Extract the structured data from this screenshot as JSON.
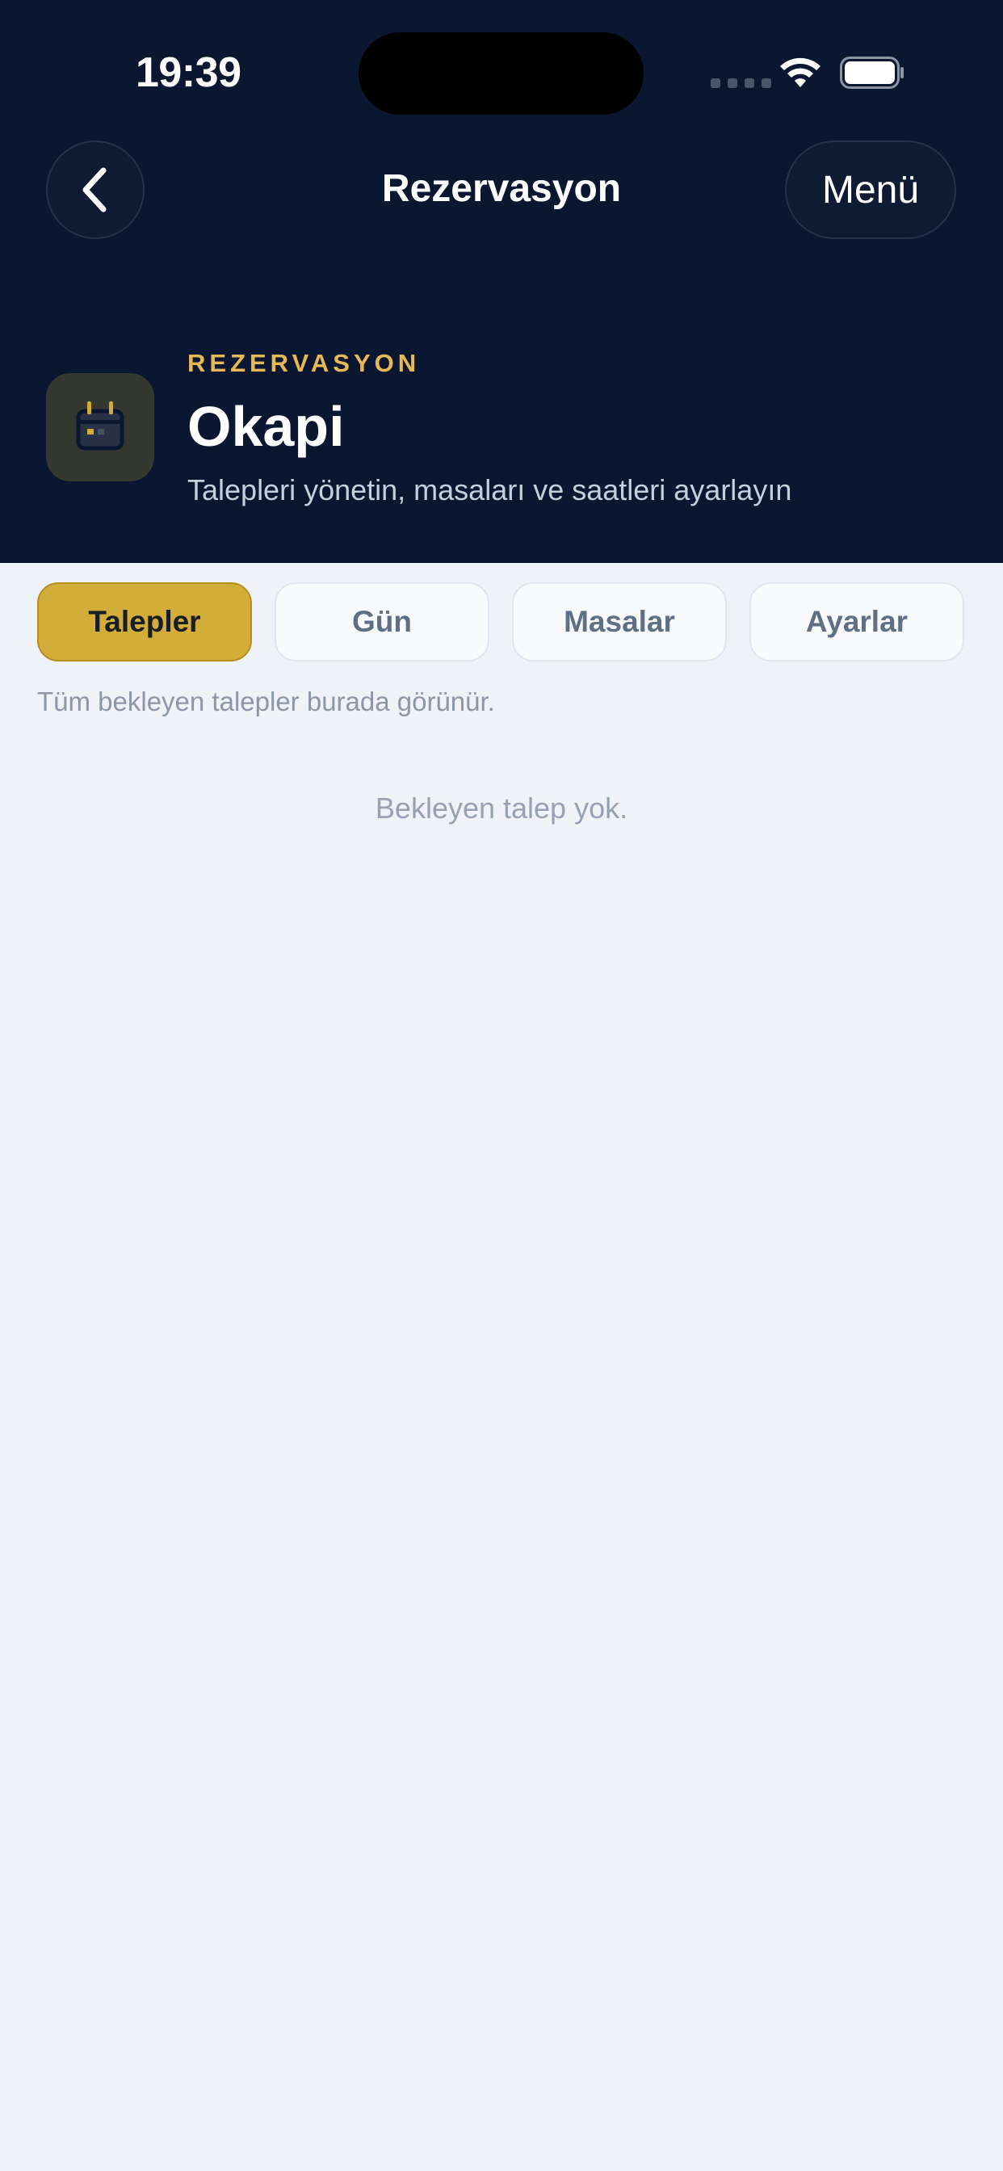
{
  "status_bar": {
    "time": "19:39"
  },
  "nav": {
    "title": "Rezervasyon",
    "menu_label": "Menü",
    "back_icon": "chevron-left-icon"
  },
  "hero": {
    "eyebrow": "REZERVASYON",
    "title": "Okapi",
    "subtitle": "Talepleri yönetin, masaları ve saatleri ayarlayın",
    "icon": "calendar-icon"
  },
  "tabs": [
    {
      "label": "Talepler",
      "active": true
    },
    {
      "label": "Gün",
      "active": false
    },
    {
      "label": "Masalar",
      "active": false
    },
    {
      "label": "Ayarlar",
      "active": false
    }
  ],
  "content": {
    "hint": "Tüm bekleyen talepler burada görünür.",
    "empty_message": "Bekleyen talep yok."
  },
  "colors": {
    "header_bg": "#0b1730",
    "accent": "#d3ad3a",
    "eyebrow": "#e7b955",
    "page_bg": "#eff2f7"
  }
}
